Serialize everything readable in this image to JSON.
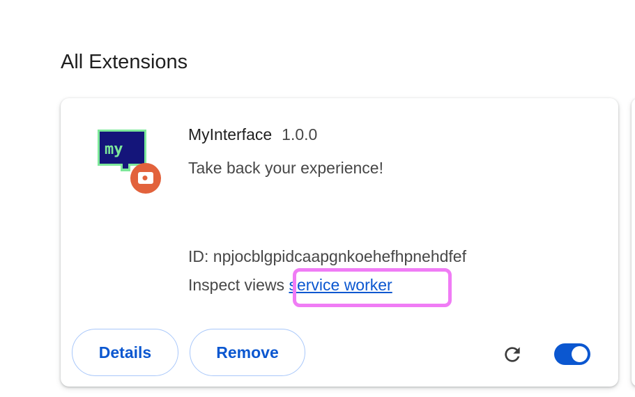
{
  "section": {
    "title": "All Extensions"
  },
  "extension": {
    "icon": "myinterface-logo-icon",
    "badge_icon": "extension-badge-icon",
    "name": "MyInterface",
    "version": "1.0.0",
    "description": "Take back your experience!",
    "id_text": "ID: npjocblgpidcaapgnkoehefhpnehdfef",
    "inspect_label": "Inspect views ",
    "inspect_link": "service worker",
    "enabled": true
  },
  "actions": {
    "details_label": "Details",
    "remove_label": "Remove",
    "reload_icon": "reload-icon"
  },
  "colors": {
    "accent": "#0b57d0",
    "button_border": "#a8c7fa",
    "highlight": "#f07cf5",
    "icon_bubble": "#14157a",
    "icon_outline": "#7de89a",
    "badge": "#e2623c"
  }
}
